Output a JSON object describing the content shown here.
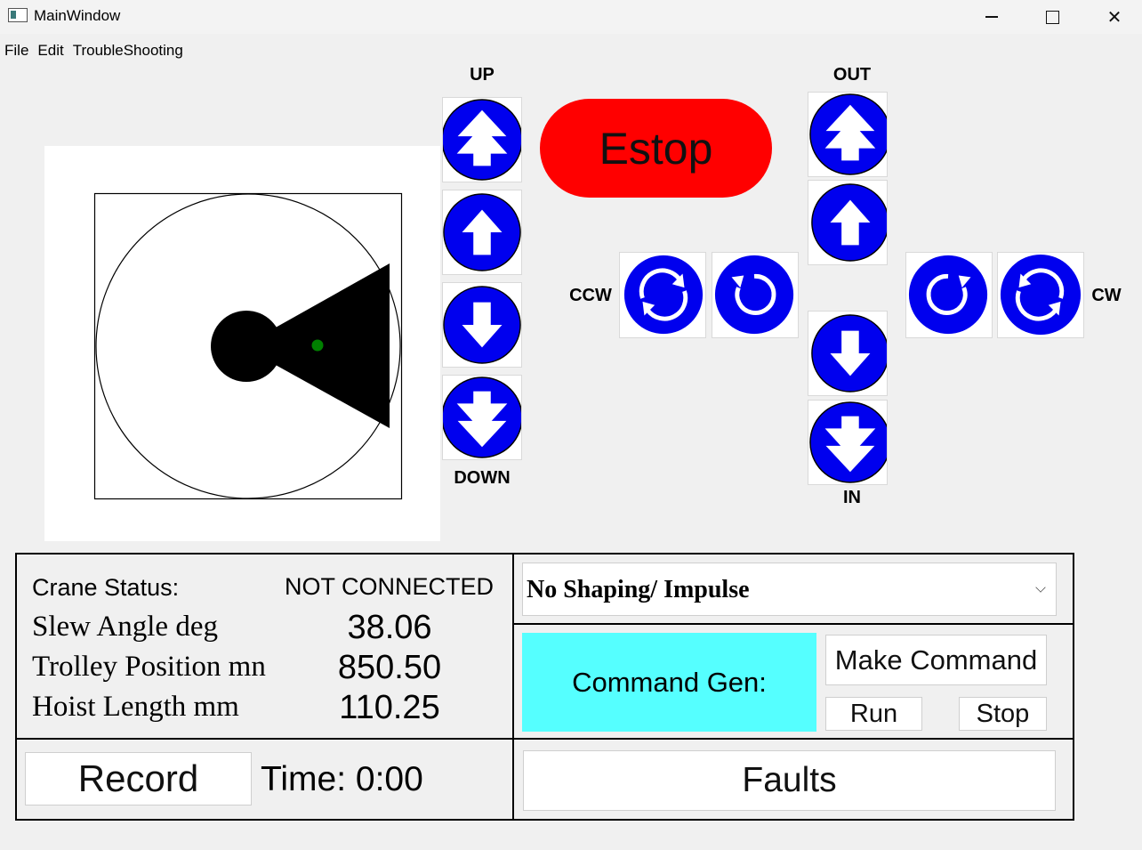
{
  "window": {
    "title": "MainWindow",
    "close_glyph": "✕",
    "controls": [
      "minimize-icon",
      "maximize-icon",
      "close-icon"
    ]
  },
  "menu": [
    "File",
    "Edit",
    "TroubleShooting"
  ],
  "hoist": {
    "up_label": "UP",
    "down_label": "DOWN"
  },
  "trolley": {
    "out_label": "OUT",
    "in_label": "IN"
  },
  "slew": {
    "ccw_label": "CCW",
    "cw_label": "CW"
  },
  "estop": {
    "label": "Estop",
    "color": "#ff0000"
  },
  "jog_color": "#0000ee",
  "status": {
    "crane_status_label": "Crane Status:",
    "crane_status_value": "NOT CONNECTED",
    "slew_label": "Slew Angle deg",
    "slew_value": "38.06",
    "trolley_label": "Trolley Position mn",
    "trolley_value": "850.50",
    "hoist_label": "Hoist Length mm",
    "hoist_value": "110.25"
  },
  "shaping": {
    "selected": "No Shaping/ Impulse"
  },
  "command": {
    "gen_label": "Command Gen:",
    "gen_color": "#55ffff",
    "make_label": "Make Command",
    "run_label": "Run",
    "stop_label": "Stop"
  },
  "record": {
    "label": "Record",
    "time_text": "Time: 0:00"
  },
  "faults": {
    "label": "Faults"
  }
}
